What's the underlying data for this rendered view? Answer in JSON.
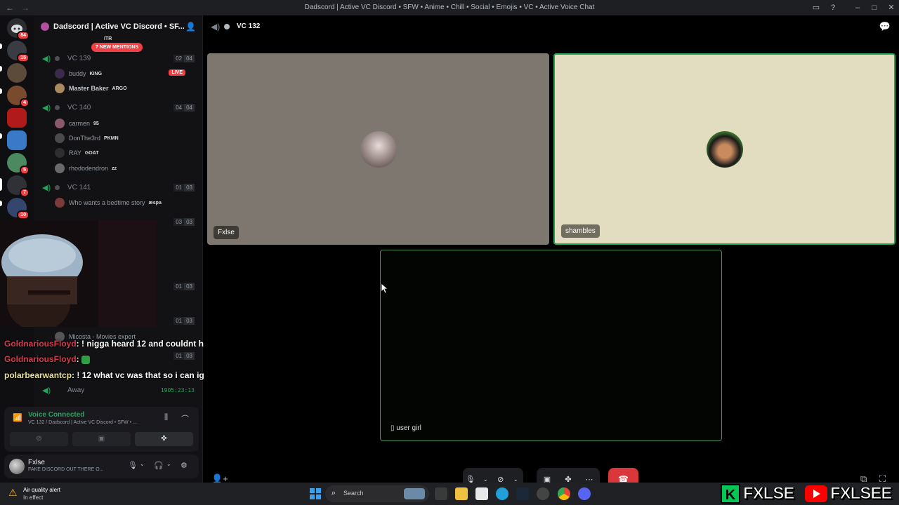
{
  "window": {
    "title": "Dadscord | Active VC Discord • SFW • Anime • Chill • Social • Emojis • VC • Active Voice Chat"
  },
  "server_rail": {
    "badges": [
      "84",
      "15",
      "4",
      "5",
      "7",
      "10"
    ]
  },
  "sidebar": {
    "guild_name": "Dadscord | Active VC Discord • SF...",
    "mentions_pill": "7 NEW MENTIONS",
    "partial_member_tag": "ITR",
    "channels": [
      {
        "name": "VC 139",
        "count_a": "02",
        "count_b": "04",
        "members": [
          {
            "name": "buddy",
            "tag": "KING",
            "live": "LIVE"
          },
          {
            "name": "Master Baker",
            "tag": "ARGO"
          }
        ]
      },
      {
        "name": "VC 140",
        "count_a": "04",
        "count_b": "04",
        "members": [
          {
            "name": "carmen",
            "tag": "95"
          },
          {
            "name": "DonThe3rd",
            "tag": "PKMN"
          },
          {
            "name": "RAY",
            "tag": "GOAT"
          },
          {
            "name": "rhododendron",
            "tag": "zz"
          }
        ]
      },
      {
        "name": "VC 141",
        "count_a": "01",
        "count_b": "03",
        "members": [
          {
            "name": "Who wants a bedtime story",
            "tag": "æspa"
          }
        ]
      }
    ],
    "hidden_counts": [
      {
        "a": "03",
        "b": "03"
      },
      {
        "a": "01",
        "b": "03"
      },
      {
        "a": "01",
        "b": "03"
      },
      {
        "a": "01",
        "b": "03"
      }
    ],
    "partial_member": "Micosta - Movies expert",
    "away_row": {
      "label": "Away",
      "timer": "1905:23:13"
    }
  },
  "stream_chat": [
    {
      "user": "GoldnariousFloyd",
      "message": ": ! nigga heard 12 and couldnt hold back himself"
    },
    {
      "user": "GoldnariousFloyd",
      "message": ":"
    },
    {
      "user": "polarbearwantcp",
      "message": ": ! 12 what vc was that so i can ignore that"
    }
  ],
  "voice_panel": {
    "status": "Voice Connected",
    "subtitle": "VC 132 / Dadscord | Active VC Discord • SFW • ..."
  },
  "user_panel": {
    "name": "Fxlse",
    "status": "FAKE DISCORD OUT THERE O..."
  },
  "main": {
    "channel_name": "VC 132",
    "tiles": [
      {
        "label": "Fxlse"
      },
      {
        "label": "shambles"
      },
      {
        "label": "user girl"
      }
    ]
  },
  "taskbar": {
    "alert_title": "Air quality alert",
    "alert_sub": "In effect",
    "search": "Search"
  },
  "overlay_brand": {
    "left": "FXLSE",
    "right": "FXLSEE"
  },
  "colors": {
    "accent_green": "#23a55a",
    "danger_red": "#da373c",
    "tile_one_bg": "#7d776f",
    "tile_two_bg": "#e2dcc0"
  }
}
